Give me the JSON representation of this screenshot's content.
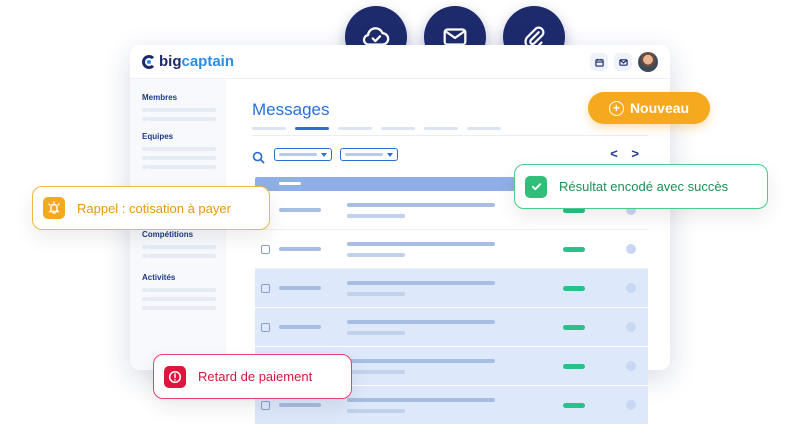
{
  "top_icons": [
    {
      "name": "cloud-check-icon"
    },
    {
      "name": "mail-icon"
    },
    {
      "name": "paperclip-icon"
    }
  ],
  "app": {
    "brand_big": "big",
    "brand_captain": "captain",
    "page_title": "Messages",
    "pager": "< >",
    "search_icon": "⚲"
  },
  "sidebar": {
    "sections": [
      "Membres",
      "Equipes",
      "Compétitions",
      "Activités"
    ]
  },
  "actions": {
    "new_label": "Nouveau"
  },
  "notifications": {
    "reminder": "Rappel : cotisation à payer",
    "success": "Résultat encodé avec succès",
    "late": "Retard de paiement"
  },
  "colors": {
    "navy": "#1d2a6b",
    "blue": "#2a6fd6",
    "orange": "#f5a91f",
    "green": "#2fbf78",
    "red": "#e0153f"
  }
}
